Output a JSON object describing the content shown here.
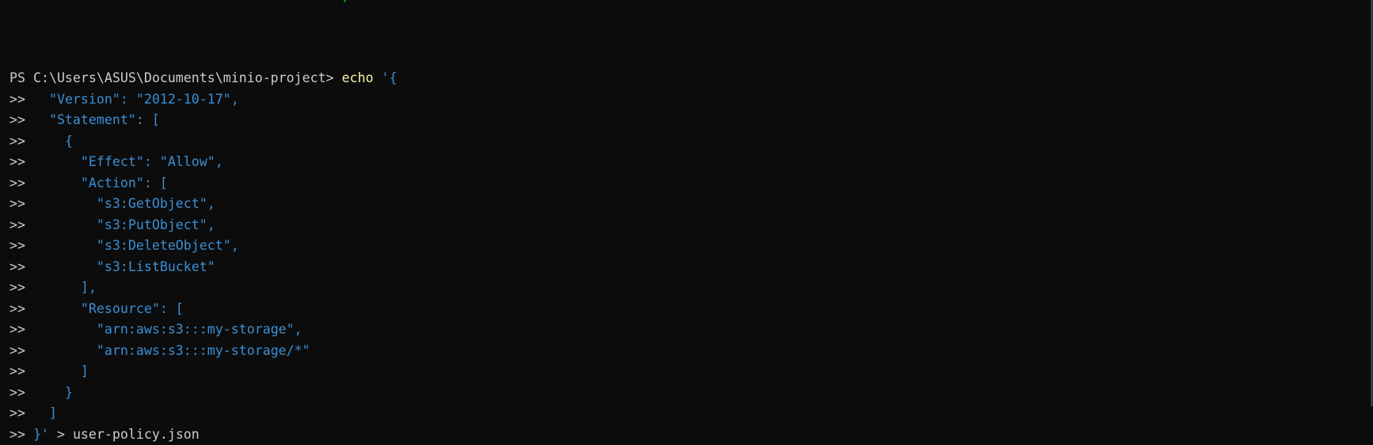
{
  "terminal": {
    "colors": {
      "background": "#0c0c0c",
      "default": "#cccccc",
      "command": "#f9f1a5",
      "string": "#3b8fd6"
    },
    "lines": [
      [
        {
          "t": "PS C:\\Users\\ASUS\\Documents\\minio-project> ",
          "c": "default"
        },
        {
          "t": "echo",
          "c": "cmd"
        },
        {
          "t": " '{",
          "c": "str"
        }
      ],
      [
        {
          "t": ">> ",
          "c": "default"
        },
        {
          "t": "  \"Version\": \"2012-10-17\",",
          "c": "str"
        }
      ],
      [
        {
          "t": ">> ",
          "c": "default"
        },
        {
          "t": "  \"Statement\": [",
          "c": "str"
        }
      ],
      [
        {
          "t": ">> ",
          "c": "default"
        },
        {
          "t": "    {",
          "c": "str"
        }
      ],
      [
        {
          "t": ">> ",
          "c": "default"
        },
        {
          "t": "      \"Effect\": \"Allow\",",
          "c": "str"
        }
      ],
      [
        {
          "t": ">> ",
          "c": "default"
        },
        {
          "t": "      \"Action\": [",
          "c": "str"
        }
      ],
      [
        {
          "t": ">> ",
          "c": "default"
        },
        {
          "t": "        \"s3:GetObject\",",
          "c": "str"
        }
      ],
      [
        {
          "t": ">> ",
          "c": "default"
        },
        {
          "t": "        \"s3:PutObject\",",
          "c": "str"
        }
      ],
      [
        {
          "t": ">> ",
          "c": "default"
        },
        {
          "t": "        \"s3:DeleteObject\",",
          "c": "str"
        }
      ],
      [
        {
          "t": ">> ",
          "c": "default"
        },
        {
          "t": "        \"s3:ListBucket\"",
          "c": "str"
        }
      ],
      [
        {
          "t": ">> ",
          "c": "default"
        },
        {
          "t": "      ],",
          "c": "str"
        }
      ],
      [
        {
          "t": ">> ",
          "c": "default"
        },
        {
          "t": "      \"Resource\": [",
          "c": "str"
        }
      ],
      [
        {
          "t": ">> ",
          "c": "default"
        },
        {
          "t": "        \"arn:aws:s3:::my-storage\",",
          "c": "str"
        }
      ],
      [
        {
          "t": ">> ",
          "c": "default"
        },
        {
          "t": "        \"arn:aws:s3:::my-storage/*\"",
          "c": "str"
        }
      ],
      [
        {
          "t": ">> ",
          "c": "default"
        },
        {
          "t": "      ]",
          "c": "str"
        }
      ],
      [
        {
          "t": ">> ",
          "c": "default"
        },
        {
          "t": "    }",
          "c": "str"
        }
      ],
      [
        {
          "t": ">> ",
          "c": "default"
        },
        {
          "t": "  ]",
          "c": "str"
        }
      ],
      [
        {
          "t": ">> ",
          "c": "default"
        },
        {
          "t": "}'",
          "c": "str"
        },
        {
          "t": " > user-policy.json",
          "c": "default"
        }
      ]
    ]
  }
}
